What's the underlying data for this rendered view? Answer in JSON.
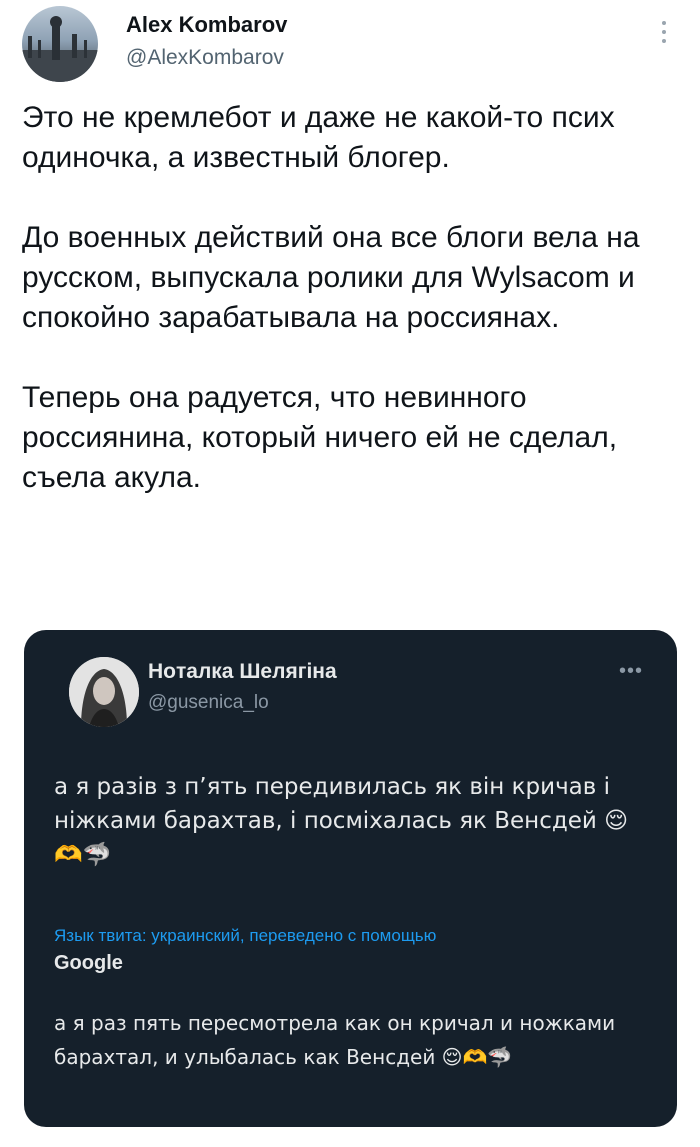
{
  "author": {
    "name": "Alex Kombarov",
    "handle": "@AlexKombarov"
  },
  "tweet": {
    "paragraphs": [
      "Это не кремлебот и даже не какой-то псих одиночка, а известный блогер.",
      "До военных действий она все блоги вела на русском, выпускала ролики для Wylsacom и спокойно зарабатывала на россиянах.",
      "Теперь она радуется, что невинного россиянина, который ничего ей не сделал, съела акула."
    ]
  },
  "quoted": {
    "name": "Нoталка Шелягіна",
    "handle": "@gusenica_lo",
    "text": "а я разів з п’ять передивилась як він кричав і ніжками барахтав, і посміхалась як Венсдей 😌🫶🦈",
    "translation_label": "Язык твита: украинский, переведено с помощью",
    "translation_provider": "Google",
    "translation": "а я раз пять пересмотрела как он кричал и ножками барахтал, и улыбалась как Венсдей 😌🫶🦈"
  }
}
